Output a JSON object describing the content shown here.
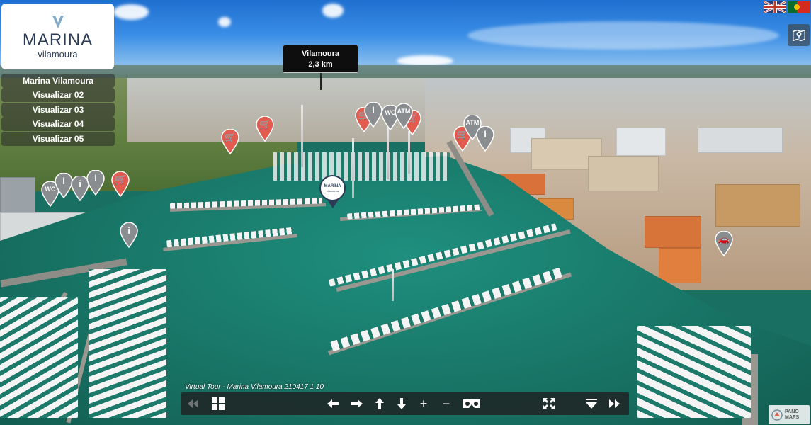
{
  "logo": {
    "title": "MARINA",
    "subtitle": "vilamoura",
    "brand_color": "#2b3a55"
  },
  "nav": {
    "items": [
      {
        "label": "Marina Vilamoura"
      },
      {
        "label": "Visualizar 02"
      },
      {
        "label": "Visualizar 03"
      },
      {
        "label": "Visualizar 04"
      },
      {
        "label": "Visualizar 05"
      }
    ]
  },
  "tooltip": {
    "place": "Vilamoura",
    "distance": "2,3 km"
  },
  "marina_pin": {
    "title": "MARINA",
    "subtitle": "vilamoura"
  },
  "hotspots": {
    "wc_label": "WC",
    "atm_label": "ATM",
    "info_label": "i",
    "shop_icon": "shopping-cart-icon",
    "car_icon": "car-icon"
  },
  "languages": [
    {
      "name": "English",
      "icon": "uk-flag-icon"
    },
    {
      "name": "Português",
      "icon": "portugal-flag-icon"
    }
  ],
  "caption": "Virtual Tour - Marina Vilamoura 210417 1 10",
  "controls": [
    {
      "name": "previous",
      "icon": "double-left-arrow-icon"
    },
    {
      "name": "thumbnails",
      "icon": "grid-icon"
    },
    {
      "name": "left",
      "icon": "arrow-left-icon"
    },
    {
      "name": "right",
      "icon": "arrow-right-icon"
    },
    {
      "name": "up",
      "icon": "arrow-up-icon"
    },
    {
      "name": "down",
      "icon": "arrow-down-icon"
    },
    {
      "name": "zoom-in",
      "glyph": "+"
    },
    {
      "name": "zoom-out",
      "glyph": "−"
    },
    {
      "name": "vr",
      "icon": "vr-headset-icon"
    },
    {
      "name": "fullscreen",
      "icon": "fullscreen-icon"
    },
    {
      "name": "hide-bar",
      "icon": "hide-bar-icon"
    },
    {
      "name": "next",
      "icon": "double-right-arrow-icon"
    }
  ],
  "panomaps": {
    "line1": "PANO",
    "line2": "MAPS"
  },
  "colors": {
    "shop_pin": "#e25b4f",
    "gray_pin": "#8a8d90",
    "water": "#187566"
  }
}
